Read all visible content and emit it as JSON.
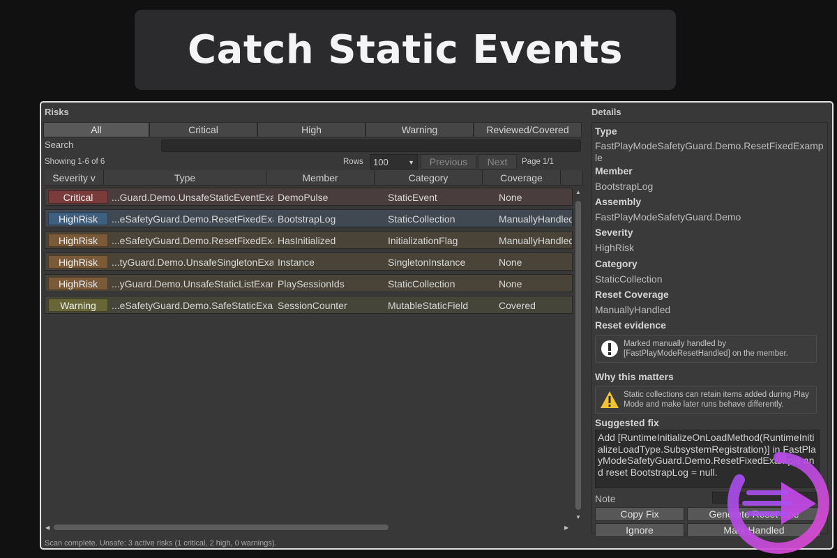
{
  "banner": {
    "title": "Catch Static Events"
  },
  "risks": {
    "title": "Risks",
    "tabs": [
      "All",
      "Critical",
      "High",
      "Warning",
      "Reviewed/Covered"
    ],
    "active_tab": "All",
    "search_label": "Search",
    "search_value": "",
    "showing": "Showing 1-6 of 6",
    "rows_label": "Rows",
    "rows_value": "100",
    "previous_label": "Previous",
    "next_label": "Next",
    "page_label": "Page 1/1",
    "columns": [
      "Severity v",
      "Type",
      "Member",
      "Category",
      "Coverage"
    ],
    "rows": [
      {
        "severity": "Critical",
        "type": "...Guard.Demo.UnsafeStaticEventExa",
        "member": "DemoPulse",
        "category": "StaticEvent",
        "coverage": "None"
      },
      {
        "severity": "HighRisk",
        "type": "...eSafetyGuard.Demo.ResetFixedExa",
        "member": "BootstrapLog",
        "category": "StaticCollection",
        "coverage": "ManuallyHandled"
      },
      {
        "severity": "HighRisk",
        "type": "...eSafetyGuard.Demo.ResetFixedExa",
        "member": "HasInitialized",
        "category": "InitializationFlag",
        "coverage": "ManuallyHandled"
      },
      {
        "severity": "HighRisk",
        "type": "...tyGuard.Demo.UnsafeSingletonExa",
        "member": "Instance",
        "category": "SingletonInstance",
        "coverage": "None"
      },
      {
        "severity": "HighRisk",
        "type": "...yGuard.Demo.UnsafeStaticListExan",
        "member": "PlaySessionIds",
        "category": "StaticCollection",
        "coverage": "None"
      },
      {
        "severity": "Warning",
        "type": "...eSafetyGuard.Demo.SafeStaticExar",
        "member": "SessionCounter",
        "category": "MutableStaticField",
        "coverage": "Covered"
      }
    ],
    "selected_row": 1,
    "status": "Scan complete. Unsafe: 3 active risks (1 critical, 2 high, 0 warnings)."
  },
  "details": {
    "title": "Details",
    "type_label": "Type",
    "type_value": "FastPlayModeSafetyGuard.Demo.ResetFixedExample",
    "member_label": "Member",
    "member_value": "BootstrapLog",
    "assembly_label": "Assembly",
    "assembly_value": "FastPlayModeSafetyGuard.Demo",
    "severity_label": "Severity",
    "severity_value": "HighRisk",
    "category_label": "Category",
    "category_value": "StaticCollection",
    "coverage_label": "Reset Coverage",
    "coverage_value": "ManuallyHandled",
    "evidence_label": "Reset evidence",
    "evidence_text": "Marked manually handled by [FastPlayModeResetHandled] on the member.",
    "why_label": "Why this matters",
    "why_text": "Static collections can retain items added during Play Mode and make later runs behave differently.",
    "fix_label": "Suggested fix",
    "fix_text": "Add [RuntimeInitializeOnLoadMethod(RuntimeInitializeLoadType.SubsystemRegistration)] in FastPlayModeSafetyGuard.Demo.ResetFixedExample and reset BootstrapLog = null.",
    "note_label": "Note",
    "note_value": "",
    "copy_fix_label": "Copy Fix",
    "generate_label": "Generate Reset Line",
    "ignore_label": "Ignore",
    "mark_handled_label": "Mark Handled"
  },
  "colors": {
    "critical": "#7a3b3b",
    "highrisk": "#7a5a38",
    "highrisk_selected": "#3f5f7e",
    "warning": "#686636",
    "logo_purple": "#a648e0",
    "logo_magenta": "#d246d8"
  },
  "icons": [
    "info-icon",
    "warning-icon",
    "caret-down-icon",
    "scroll-up-icon",
    "scroll-down-icon",
    "scroll-left-icon",
    "scroll-right-icon",
    "play-logo-icon"
  ]
}
